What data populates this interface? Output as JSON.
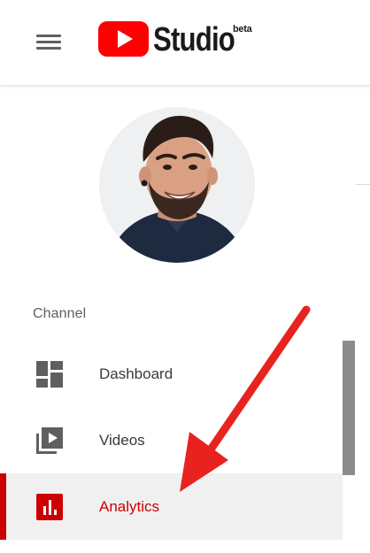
{
  "app": {
    "logo_word": "Studio",
    "logo_badge": "beta"
  },
  "header": {
    "menu_icon": "hamburger-menu-icon",
    "logo_icon": "youtube-play-icon"
  },
  "channel": {
    "section_label": "Channel",
    "avatar_icon": "channel-avatar"
  },
  "nav": {
    "items": [
      {
        "label": "Dashboard",
        "icon": "dashboard-icon",
        "active": false
      },
      {
        "label": "Videos",
        "icon": "videos-icon",
        "active": false
      },
      {
        "label": "Analytics",
        "icon": "analytics-icon",
        "active": true
      }
    ]
  },
  "colors": {
    "brand_red": "#ff0000",
    "active_red": "#cc0000",
    "active_bg": "#f0f0f0",
    "icon_gray": "#606060",
    "annotation_arrow": "#e8231f"
  }
}
